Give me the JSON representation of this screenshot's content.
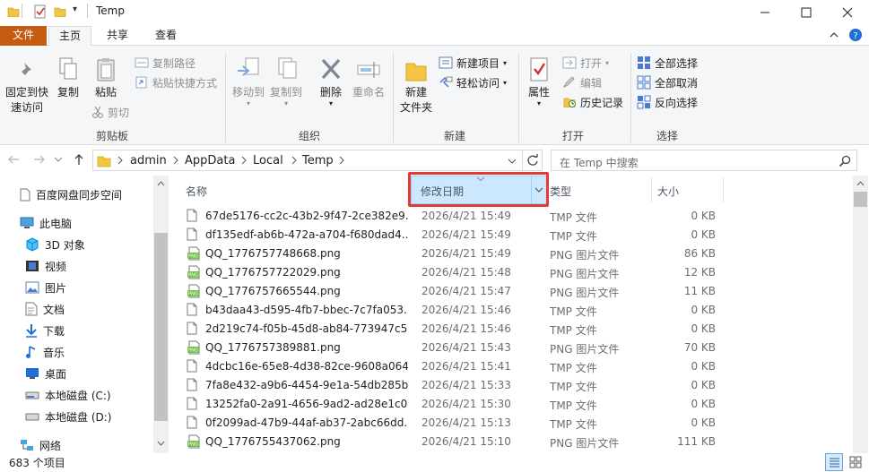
{
  "window": {
    "title": "Temp",
    "quick_access_dropdown": "▾"
  },
  "ribbon_tabs": [
    {
      "label": "文件"
    },
    {
      "label": "主页"
    },
    {
      "label": "共享"
    },
    {
      "label": "查看"
    }
  ],
  "ribbon": {
    "clipboard": {
      "pin": "固定到快\n速访问",
      "copy": "复制",
      "paste": "粘贴",
      "copy_path": "复制路径",
      "paste_shortcut": "粘贴快捷方式",
      "cut": "剪切",
      "title": "剪贴板"
    },
    "organize": {
      "move_to": "移动到",
      "copy_to": "复制到",
      "delete": "删除",
      "rename": "重命名",
      "title": "组织"
    },
    "new": {
      "new_folder": "新建\n文件夹",
      "new_item": "新建项目",
      "easy_access": "轻松访问",
      "title": "新建"
    },
    "open": {
      "properties": "属性",
      "open": "打开",
      "edit": "编辑",
      "history": "历史记录",
      "title": "打开"
    },
    "select": {
      "select_all": "全部选择",
      "select_none": "全部取消",
      "invert": "反向选择",
      "title": "选择"
    }
  },
  "address": {
    "crumbs": [
      "admin",
      "AppData",
      "Local",
      "Temp"
    ],
    "search_placeholder": "在 Temp 中搜索"
  },
  "nav": [
    {
      "label": "百度网盘同步空间",
      "icon": "document-icon"
    },
    {
      "label": "此电脑",
      "icon": "computer-icon"
    },
    {
      "label": "3D 对象",
      "icon": "cube-icon"
    },
    {
      "label": "视频",
      "icon": "video-icon"
    },
    {
      "label": "图片",
      "icon": "pictures-icon"
    },
    {
      "label": "文档",
      "icon": "documents-icon"
    },
    {
      "label": "下载",
      "icon": "download-icon"
    },
    {
      "label": "音乐",
      "icon": "music-icon"
    },
    {
      "label": "桌面",
      "icon": "desktop-icon"
    },
    {
      "label": "本地磁盘 (C:)",
      "icon": "drive-icon"
    },
    {
      "label": "本地磁盘 (D:)",
      "icon": "drive-icon"
    },
    {
      "label": "网络",
      "icon": "network-icon"
    }
  ],
  "columns": {
    "name": "名称",
    "date": "修改日期",
    "type": "类型",
    "size": "大小"
  },
  "files": [
    {
      "name": "67de5176-cc2c-43b2-9f47-2ce382e9...",
      "date": "2026/4/21 15:49",
      "type": "TMP 文件",
      "size": "0 KB",
      "kind": "tmp"
    },
    {
      "name": "df135edf-ab6b-472a-a704-f680dad4...",
      "date": "2026/4/21 15:49",
      "type": "TMP 文件",
      "size": "0 KB",
      "kind": "tmp"
    },
    {
      "name": "QQ_1776757748668.png",
      "date": "2026/4/21 15:49",
      "type": "PNG 图片文件",
      "size": "86 KB",
      "kind": "png"
    },
    {
      "name": "QQ_1776757722029.png",
      "date": "2026/4/21 15:48",
      "type": "PNG 图片文件",
      "size": "12 KB",
      "kind": "png"
    },
    {
      "name": "QQ_1776757665544.png",
      "date": "2026/4/21 15:47",
      "type": "PNG 图片文件",
      "size": "11 KB",
      "kind": "png"
    },
    {
      "name": "b43daa43-d595-4fb7-bbec-7c7fa053...",
      "date": "2026/4/21 15:46",
      "type": "TMP 文件",
      "size": "0 KB",
      "kind": "tmp"
    },
    {
      "name": "2d219c74-f05b-45d8-ab84-773947c5...",
      "date": "2026/4/21 15:46",
      "type": "TMP 文件",
      "size": "0 KB",
      "kind": "tmp"
    },
    {
      "name": "QQ_1776757389881.png",
      "date": "2026/4/21 15:43",
      "type": "PNG 图片文件",
      "size": "70 KB",
      "kind": "png"
    },
    {
      "name": "4dcbc16e-65e8-4d38-82ce-9608a064...",
      "date": "2026/4/21 15:41",
      "type": "TMP 文件",
      "size": "0 KB",
      "kind": "tmp"
    },
    {
      "name": "7fa8e432-a9b6-4454-9e1a-54db285b...",
      "date": "2026/4/21 15:33",
      "type": "TMP 文件",
      "size": "0 KB",
      "kind": "tmp"
    },
    {
      "name": "13252fa0-2a91-4656-9ad2-ad28e1c0...",
      "date": "2026/4/21 15:30",
      "type": "TMP 文件",
      "size": "0 KB",
      "kind": "tmp"
    },
    {
      "name": "0f2099ad-47b9-44af-ab37-2abc66dd...",
      "date": "2026/4/21 15:13",
      "type": "TMP 文件",
      "size": "0 KB",
      "kind": "tmp"
    },
    {
      "name": "QQ_1776755437062.png",
      "date": "2026/4/21 15:10",
      "type": "PNG 图片文件",
      "size": "111 KB",
      "kind": "png"
    }
  ],
  "status": {
    "count": "683 个项目"
  },
  "colors": {
    "file_tab": "#c55a11",
    "sort_header": "#cce8ff",
    "highlight": "#e53935",
    "folder": "#f4c542"
  }
}
